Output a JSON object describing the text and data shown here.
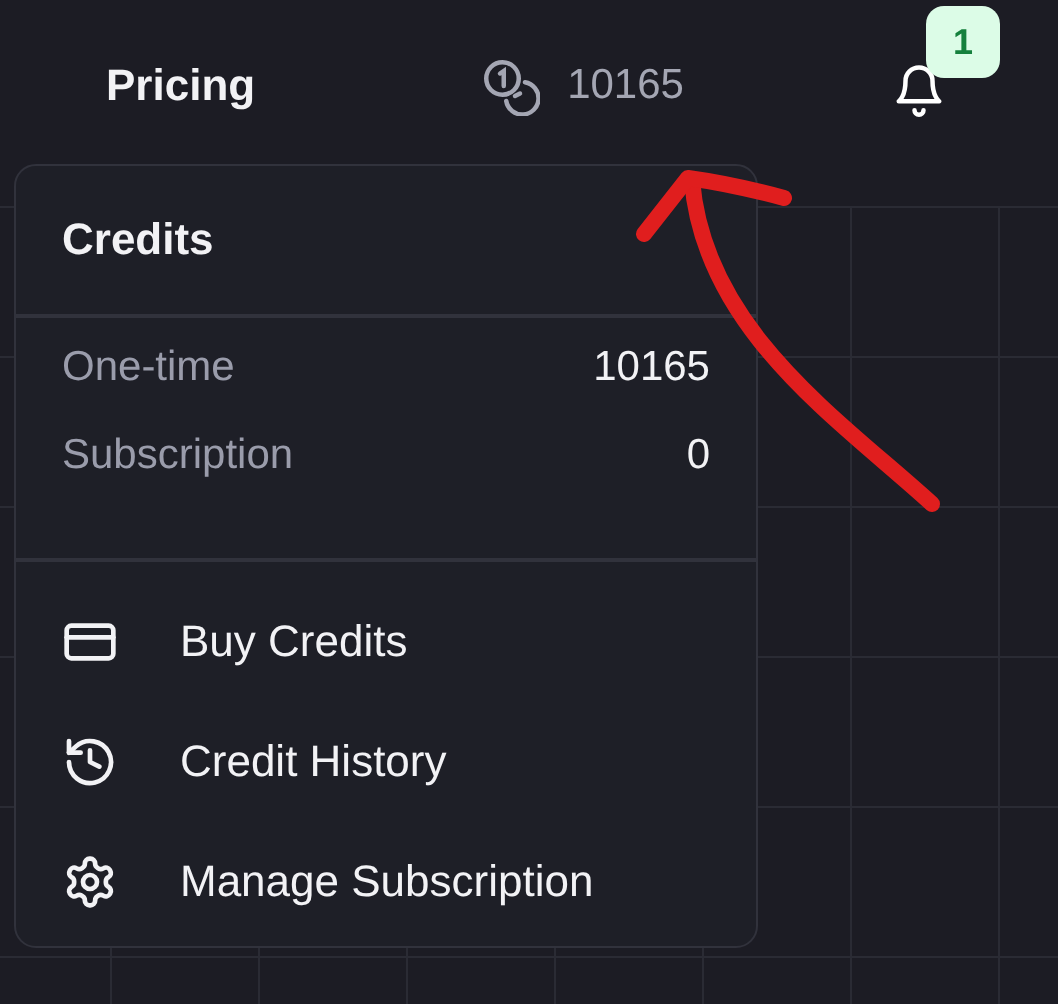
{
  "nav": {
    "pricing": "Pricing",
    "credits_count": "10165",
    "notification_count": "1"
  },
  "credits_menu": {
    "title": "Credits",
    "balances": [
      {
        "label": "One-time",
        "value": "10165"
      },
      {
        "label": "Subscription",
        "value": "0"
      }
    ],
    "items": [
      {
        "kind": "card",
        "label": "Buy Credits"
      },
      {
        "kind": "history",
        "label": "Credit History"
      },
      {
        "kind": "settings",
        "label": "Manage Subscription"
      }
    ]
  }
}
